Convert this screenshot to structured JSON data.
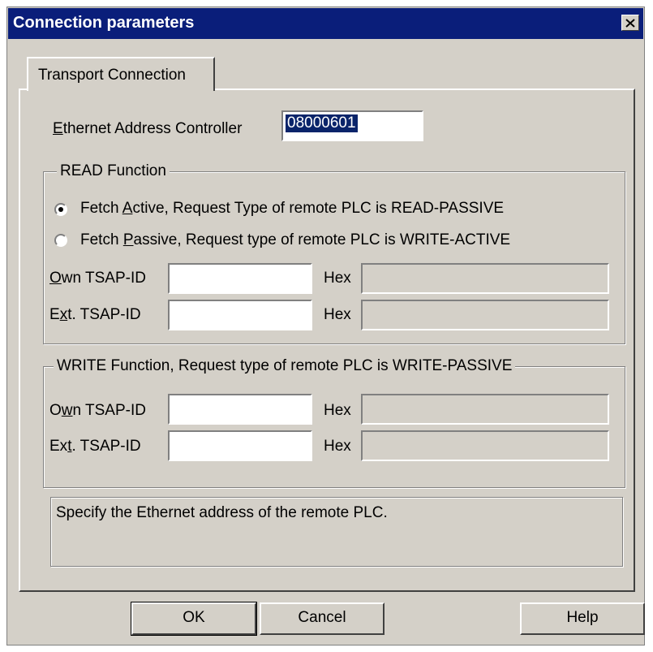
{
  "window": {
    "title": "Connection parameters"
  },
  "tab": {
    "label": "Transport Connection"
  },
  "ethernet": {
    "label_pre": "",
    "label_u": "E",
    "label_post": "thernet Address Controller",
    "value": "08000601"
  },
  "read": {
    "legend": "READ Function",
    "fetch_active": {
      "pre": "Fetch ",
      "u": "A",
      "post": "ctive,   Request Type of remote PLC is READ-PASSIVE",
      "checked": true
    },
    "fetch_passive": {
      "pre": "Fetch ",
      "u": "P",
      "post": "assive, Request type of remote PLC is WRITE-ACTIVE",
      "checked": false
    },
    "own_tsap": {
      "pre": "",
      "u": "O",
      "post": "wn TSAP-ID",
      "value": "",
      "hex_label": "Hex",
      "hex_value": ""
    },
    "ext_tsap": {
      "pre": "E",
      "u": "x",
      "post": "t. TSAP-ID",
      "value": "",
      "hex_label": "Hex",
      "hex_value": ""
    }
  },
  "write": {
    "legend": "WRITE Function, Request type of remote PLC is WRITE-PASSIVE",
    "own_tsap": {
      "pre": "O",
      "u": "w",
      "post": "n TSAP-ID",
      "value": "",
      "hex_label": "Hex",
      "hex_value": ""
    },
    "ext_tsap": {
      "pre": "Ex",
      "u": "t",
      "post": ". TSAP-ID",
      "value": "",
      "hex_label": "Hex",
      "hex_value": ""
    }
  },
  "status_text": "Specify the Ethernet address of the remote PLC.",
  "buttons": {
    "ok": "OK",
    "cancel": "Cancel",
    "help": "Help"
  },
  "icons": {
    "close": "close-icon"
  }
}
